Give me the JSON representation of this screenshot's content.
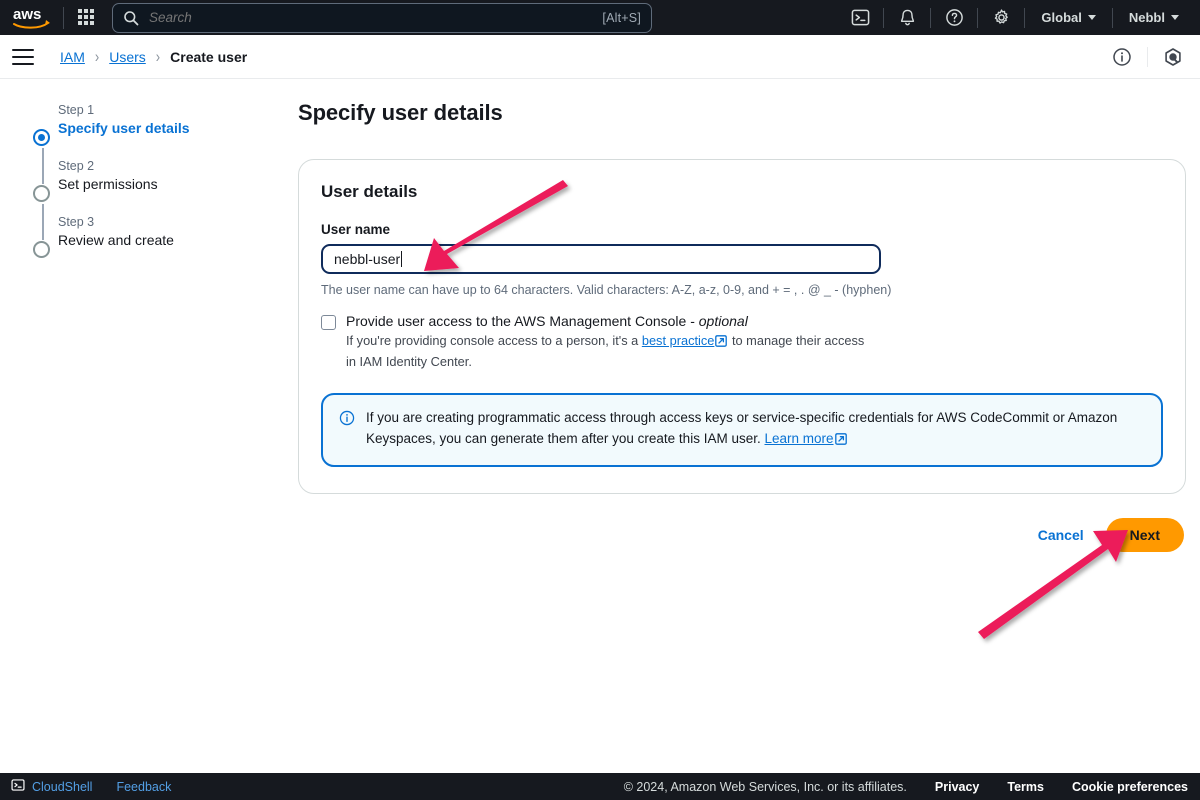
{
  "topnav": {
    "logo_alt": "aws",
    "app_grid": "app-grid-icon",
    "search": {
      "placeholder": "Search",
      "shortcut": "[Alt+S]"
    },
    "icons": [
      "cloudshell-icon",
      "notifications-icon",
      "help-icon",
      "settings-icon"
    ],
    "region_menu": "Global",
    "account_menu": "Nebbl"
  },
  "breadcrumb": {
    "items": [
      {
        "label": "IAM",
        "current": false
      },
      {
        "label": "Users",
        "current": false
      },
      {
        "label": "Create user",
        "current": true
      }
    ],
    "separator": "›",
    "right_icons": [
      "info-icon",
      "amazon-q-icon"
    ]
  },
  "stepper": {
    "steps": [
      {
        "num": "Step 1",
        "label": "Specify user details",
        "state": "active"
      },
      {
        "num": "Step 2",
        "label": "Set permissions",
        "state": "upcoming"
      },
      {
        "num": "Step 3",
        "label": "Review and create",
        "state": "upcoming"
      }
    ]
  },
  "main": {
    "page_title": "Specify user details",
    "card": {
      "title": "User details",
      "user_name": {
        "label": "User name",
        "value": "nebbl-user",
        "placeholder": "",
        "hint": "The user name can have up to 64 characters. Valid characters: A-Z, a-z, 0-9, and + = , . @ _ - (hyphen)"
      },
      "console_access": {
        "checked": false,
        "label_main": "Provide user access to the AWS Management Console -",
        "label_optional": "optional",
        "desc_before": "If you're providing console access to a person, it's a",
        "desc_link": "best practice",
        "desc_after": "to manage their access in IAM Identity Center."
      },
      "alert": {
        "icon": "info-icon",
        "text_before": "If you are creating programmatic access through access keys or service-specific credentials for AWS CodeCommit or Amazon Keyspaces, you can generate them after you create this IAM user.",
        "link": "Learn more"
      }
    },
    "actions": {
      "cancel": "Cancel",
      "next": "Next"
    }
  },
  "footer": {
    "cloudshell": "CloudShell",
    "feedback": "Feedback",
    "copyright": "© 2024, Amazon Web Services, Inc. or its affiliates.",
    "privacy": "Privacy",
    "terms": "Terms",
    "cookies": "Cookie preferences"
  },
  "annotations": {
    "arrow_color": "#ec1b5a",
    "arrow_user_name_target": "user-name-input",
    "arrow_next_target": "next-button"
  },
  "colors": {
    "nav_bg": "#16191f",
    "link": "#0972d3",
    "accent_orange": "#ff9900",
    "alert_bg": "#f2fafd",
    "alert_border": "#0972d3"
  }
}
